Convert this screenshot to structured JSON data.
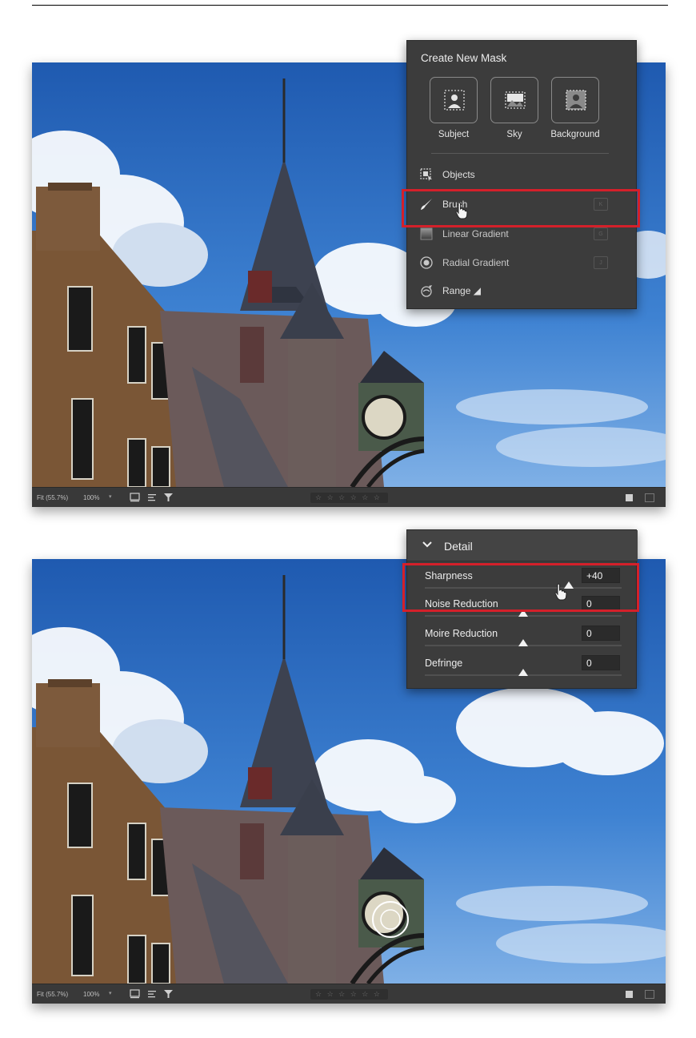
{
  "status_bar": {
    "zoom_fit": "Fit (55.7%)",
    "zoom_pct": "100%",
    "stars": "☆ ☆ ☆ ☆ ☆   ☆"
  },
  "mask_panel": {
    "title": "Create New Mask",
    "buttons": [
      {
        "label": "Subject",
        "icon": "person-select-icon"
      },
      {
        "label": "Sky",
        "icon": "sky-select-icon"
      },
      {
        "label": "Background",
        "icon": "background-select-icon"
      }
    ],
    "items": [
      {
        "label": "Objects",
        "shortcut": "",
        "icon": "object-select-icon"
      },
      {
        "label": "Brush",
        "shortcut": "K",
        "icon": "brush-icon"
      },
      {
        "label": "Linear Gradient",
        "shortcut": "G",
        "icon": "linear-gradient-icon"
      },
      {
        "label": "Radial Gradient",
        "shortcut": "J",
        "icon": "radial-gradient-icon"
      },
      {
        "label": "Range",
        "shortcut": "",
        "icon": "range-icon"
      }
    ],
    "highlighted_item": "Brush"
  },
  "detail_panel": {
    "title": "Detail",
    "sliders": [
      {
        "label": "Sharpness",
        "value": "+40",
        "level": 0.73
      },
      {
        "label": "Noise Reduction",
        "value": "0",
        "level": 0.5
      },
      {
        "label": "Moire Reduction",
        "value": "0",
        "level": 0.5
      },
      {
        "label": "Defringe",
        "value": "0",
        "level": 0.5
      }
    ],
    "highlighted_row": "Sharpness"
  },
  "colors": {
    "highlight": "#d4202a",
    "panel_bg": "#3c3c3c",
    "sky": "#2a6cc0"
  }
}
